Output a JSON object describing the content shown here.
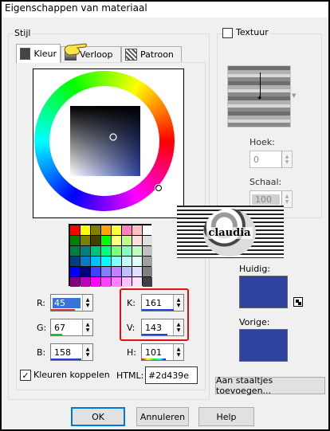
{
  "title": "Eigenschappen van materiaal",
  "stijl": {
    "group_label": "Stijl",
    "tabs": [
      {
        "label": "Kleur",
        "active": true
      },
      {
        "label": "Verloop",
        "active": false
      },
      {
        "label": "Patroon",
        "active": false
      }
    ]
  },
  "textuur": {
    "checkbox_label": "Textuur",
    "checked": false,
    "hoek_label": "Hoek:",
    "hoek_value": "0",
    "schaal_label": "Schaal:",
    "schaal_value": "100"
  },
  "current_color": "#2d439e",
  "swatches": [
    [
      "#ff0000",
      "#ffff00",
      "#808000",
      "#ffa500",
      "#ffff40",
      "#ff80c0",
      "#ffc0c0",
      "#ffffff"
    ],
    [
      "#008000",
      "#808000",
      "#404000",
      "#00ff00",
      "#ffff80",
      "#c0ff80",
      "#ffe0e0",
      "#e0e0e0"
    ],
    [
      "#008040",
      "#008080",
      "#00c080",
      "#00ff80",
      "#80ff80",
      "#80ffc0",
      "#c0ffc0",
      "#c0c0c0"
    ],
    [
      "#004080",
      "#0080c0",
      "#00c0ff",
      "#00ffff",
      "#80ffff",
      "#c0ffff",
      "#e0ffff",
      "#a0a0a0"
    ],
    [
      "#0000ff",
      "#000080",
      "#4040ff",
      "#8080ff",
      "#c080ff",
      "#c0c0ff",
      "#e0e0ff",
      "#808080"
    ],
    [
      "#800080",
      "#c000c0",
      "#ff00ff",
      "#ff40ff",
      "#ff80ff",
      "#ffc0ff",
      "#ffe0ff",
      "#404040"
    ]
  ],
  "values": {
    "r_label": "R:",
    "r": "45",
    "g_label": "G:",
    "g": "67",
    "b_label": "B:",
    "b": "158",
    "k_label": "K:",
    "k": "161",
    "v_label": "V:",
    "v": "143",
    "h_label": "H:",
    "h": "101",
    "html_label": "HTML:",
    "html": "#2d439e"
  },
  "kleuren_koppelen": {
    "label": "Kleuren koppelen",
    "checked": true
  },
  "huidig_label": "Huidig:",
  "vorige_label": "Vorige:",
  "add_swatch_label": "Aan staaltjes toevoegen...",
  "buttons": {
    "ok": "OK",
    "annuleren": "Annuleren",
    "help": "Help"
  },
  "watermark": "claudia"
}
